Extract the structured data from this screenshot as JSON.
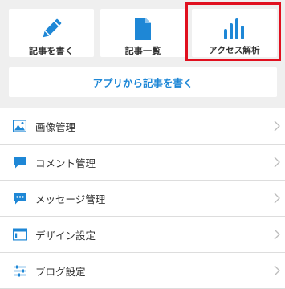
{
  "tiles": [
    {
      "label": "記事を書く",
      "icon": "pencil-icon"
    },
    {
      "label": "記事一覧",
      "icon": "document-icon"
    },
    {
      "label": "アクセス解析",
      "icon": "bar-chart-icon"
    }
  ],
  "app_post_button": {
    "label": "アプリから記事を書く"
  },
  "menu": {
    "items": [
      {
        "label": "画像管理",
        "icon": "image-icon"
      },
      {
        "label": "コメント管理",
        "icon": "comment-icon"
      },
      {
        "label": "メッセージ管理",
        "icon": "message-icon"
      },
      {
        "label": "デザイン設定",
        "icon": "window-icon"
      },
      {
        "label": "ブログ設定",
        "icon": "sliders-icon"
      }
    ]
  },
  "colors": {
    "accent": "#1e87d6",
    "highlight": "#e0101f",
    "background": "#efefef"
  }
}
